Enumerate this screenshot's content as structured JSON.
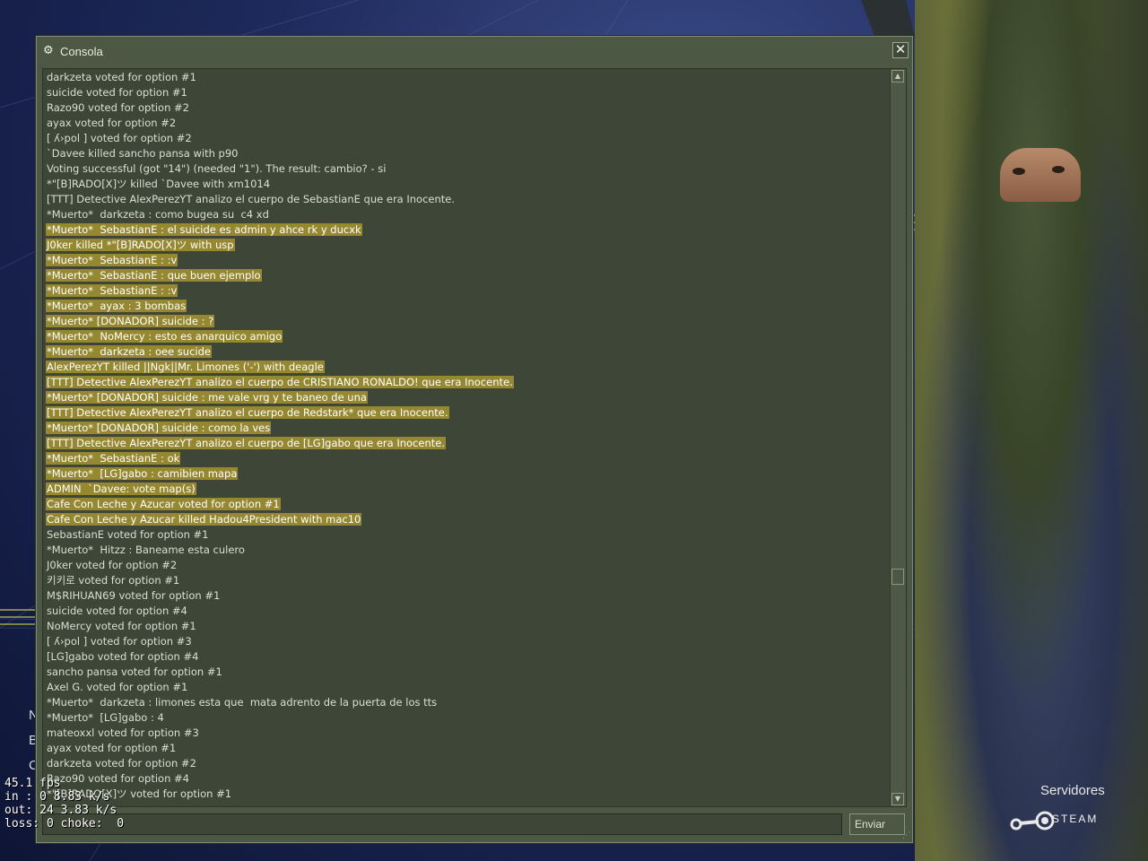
{
  "window": {
    "title": "Consola",
    "close_glyph": "✕",
    "icon": "steam-icon"
  },
  "log_lines": [
    {
      "text": "darkzeta voted for option #1",
      "sel": false
    },
    {
      "text": "suicide voted for option #1",
      "sel": false
    },
    {
      "text": "Razo90 voted for option #2",
      "sel": false
    },
    {
      "text": "ayax voted for option #2",
      "sel": false
    },
    {
      "text": "[ ʎ›pol ] voted for option #2",
      "sel": false
    },
    {
      "text": "`Davee killed sancho pansa with p90",
      "sel": false
    },
    {
      "text": "Voting successful (got \"14\") (needed \"1\"). The result: cambio? - si",
      "sel": false
    },
    {
      "text": "*\"[B]RADO[X]ツ killed `Davee with xm1014",
      "sel": false
    },
    {
      "text": "[TTT] Detective AlexPerezYT analizo el cuerpo de SebastianE que era Inocente.",
      "sel": false
    },
    {
      "text": "*Muerto*  darkzeta : como bugea su  c4 xd",
      "sel": false
    },
    {
      "text": "*Muerto*  SebastianE : el suicide es admin y ahce rk y ducxk",
      "sel": true
    },
    {
      "text": "J0ker killed *\"[B]RADO[X]ツ with usp",
      "sel": true
    },
    {
      "text": "*Muerto*  SebastianE : :v",
      "sel": true
    },
    {
      "text": "*Muerto*  SebastianE : que buen ejemplo",
      "sel": true
    },
    {
      "text": "*Muerto*  SebastianE : :v",
      "sel": true
    },
    {
      "text": "*Muerto*  ayax : 3 bombas",
      "sel": true
    },
    {
      "text": "*Muerto* [DONADOR] suicide : ?",
      "sel": true
    },
    {
      "text": "*Muerto*  NoMercy : esto es anarquico amigo",
      "sel": true
    },
    {
      "text": "*Muerto*  darkzeta : oee sucide",
      "sel": true
    },
    {
      "text": "AlexPerezYT killed ||Ngk||Mr. Limones ('-') with deagle",
      "sel": true
    },
    {
      "text": "[TTT] Detective AlexPerezYT analizo el cuerpo de CRISTIANO RONALDO! que era Inocente.",
      "sel": true
    },
    {
      "text": "*Muerto* [DONADOR] suicide : me vale vrg y te baneo de una",
      "sel": true
    },
    {
      "text": "[TTT] Detective AlexPerezYT analizo el cuerpo de Redstark* que era Inocente.",
      "sel": true
    },
    {
      "text": "*Muerto* [DONADOR] suicide : como la ves",
      "sel": true
    },
    {
      "text": "[TTT] Detective AlexPerezYT analizo el cuerpo de [LG]gabo que era Inocente.",
      "sel": true
    },
    {
      "text": "*Muerto*  SebastianE : ok",
      "sel": true
    },
    {
      "text": "*Muerto*  [LG]gabo : camibien mapa",
      "sel": true
    },
    {
      "text": "ADMIN  `Davee: vote map(s)",
      "sel": true
    },
    {
      "text": "Cafe Con Leche y Azucar voted for option #1",
      "sel": true
    },
    {
      "text": "Cafe Con Leche y Azucar killed Hadou4President with mac10",
      "sel": true
    },
    {
      "text": "SebastianE voted for option #1",
      "sel": false
    },
    {
      "text": "*Muerto*  Hitzz : Baneame esta culero",
      "sel": false
    },
    {
      "text": "J0ker voted for option #2",
      "sel": false
    },
    {
      "text": "키키로 voted for option #1",
      "sel": false
    },
    {
      "text": "M$RIHUAN69 voted for option #1",
      "sel": false
    },
    {
      "text": "suicide voted for option #4",
      "sel": false
    },
    {
      "text": "NoMercy voted for option #1",
      "sel": false
    },
    {
      "text": "[ ʎ›pol ] voted for option #3",
      "sel": false
    },
    {
      "text": "[LG]gabo voted for option #4",
      "sel": false
    },
    {
      "text": "sancho pansa voted for option #1",
      "sel": false
    },
    {
      "text": "Axel G. voted for option #1",
      "sel": false
    },
    {
      "text": "*Muerto*  darkzeta : limones esta que  mata adrento de la puerta de los tts",
      "sel": false
    },
    {
      "text": "*Muerto*  [LG]gabo : 4",
      "sel": false
    },
    {
      "text": "mateoxxl voted for option #3",
      "sel": false
    },
    {
      "text": "ayax voted for option #1",
      "sel": false
    },
    {
      "text": "darkzeta voted for option #2",
      "sel": false
    },
    {
      "text": "Razo90 voted for option #4",
      "sel": false
    },
    {
      "text": "*\"[B]RADO[X]ツ voted for option #1",
      "sel": false
    }
  ],
  "input": {
    "value": "",
    "placeholder": ""
  },
  "send_label": "Enviar",
  "netgraph": {
    "fps": "45.1 fps",
    "in": "in : 0 8.83 k/s",
    "out": "out: 24 3.83 k/s",
    "loss": "loss: 0 choke:  0"
  },
  "menu_letters": [
    "N",
    "B",
    "C"
  ],
  "servers_label": "Servidores",
  "steam_label": "STEAM",
  "colors": {
    "selection": "#958831",
    "window_bg": "#4c5844",
    "log_bg": "#3e4637"
  }
}
